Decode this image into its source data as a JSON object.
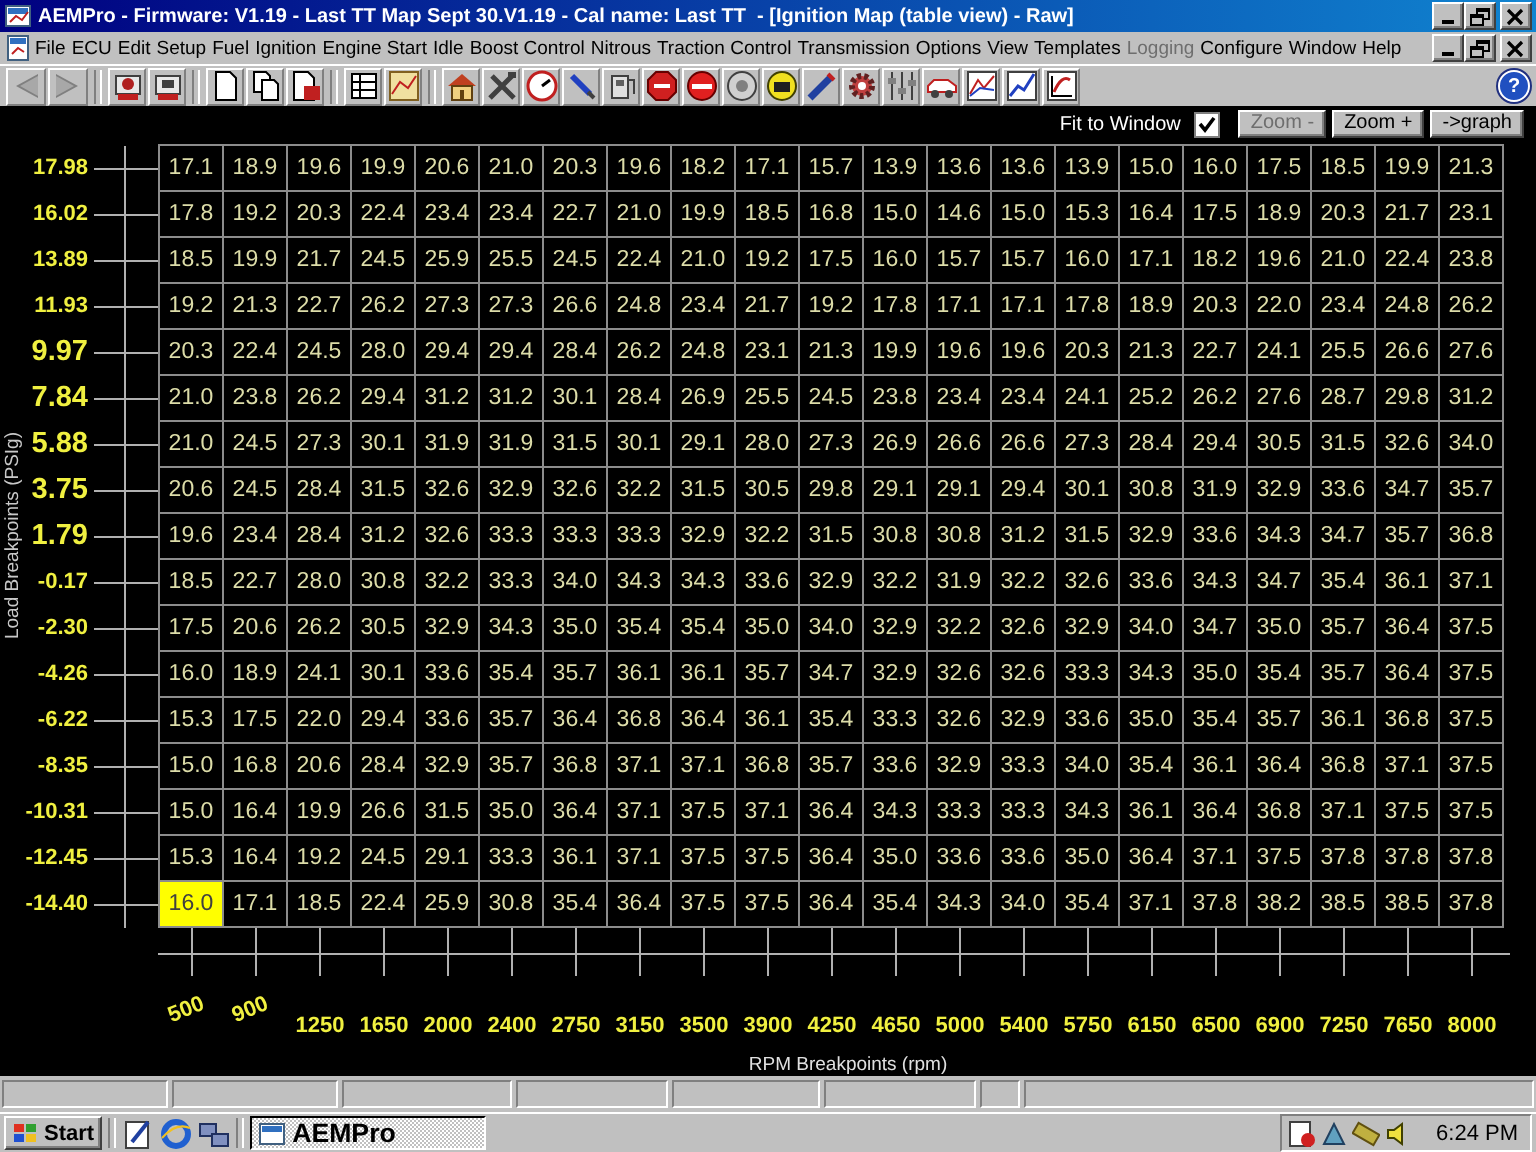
{
  "window": {
    "title": "AEMPro - Firmware: V1.19 - Last TT Map Sept 30.V1.19 - Cal name: Last TT  - [Ignition Map (table view) - Raw]"
  },
  "menu": [
    {
      "label": "File",
      "disabled": false
    },
    {
      "label": "ECU",
      "disabled": false
    },
    {
      "label": "Edit",
      "disabled": false
    },
    {
      "label": "Setup",
      "disabled": false
    },
    {
      "label": "Fuel",
      "disabled": false
    },
    {
      "label": "Ignition",
      "disabled": false
    },
    {
      "label": "Engine Start",
      "disabled": false
    },
    {
      "label": "Idle",
      "disabled": false
    },
    {
      "label": "Boost Control",
      "disabled": false
    },
    {
      "label": "Nitrous",
      "disabled": false
    },
    {
      "label": "Traction Control",
      "disabled": false
    },
    {
      "label": "Transmission",
      "disabled": false
    },
    {
      "label": "Options",
      "disabled": false
    },
    {
      "label": "View",
      "disabled": false
    },
    {
      "label": "Templates",
      "disabled": false
    },
    {
      "label": "Logging",
      "disabled": true
    },
    {
      "label": "Configure",
      "disabled": false
    },
    {
      "label": "Window",
      "disabled": false
    },
    {
      "label": "Help",
      "disabled": false
    }
  ],
  "toolbar": {
    "help_label": "?"
  },
  "view_controls": {
    "fit_label": "Fit to Window",
    "fit_checked": true,
    "buttons": [
      {
        "label": "Zoom -",
        "disabled": true
      },
      {
        "label": "Zoom +",
        "disabled": false
      },
      {
        "label": "->graph",
        "disabled": false
      }
    ]
  },
  "load_axis": {
    "title": "Load Breakpoints (PSIg)",
    "breakpoints": [
      {
        "label": "17.98",
        "large": false
      },
      {
        "label": "16.02",
        "large": false
      },
      {
        "label": "13.89",
        "large": false
      },
      {
        "label": "11.93",
        "large": false
      },
      {
        "label": "9.97",
        "large": true
      },
      {
        "label": "7.84",
        "large": true
      },
      {
        "label": "5.88",
        "large": true
      },
      {
        "label": "3.75",
        "large": true
      },
      {
        "label": "1.79",
        "large": true
      },
      {
        "label": "-0.17",
        "large": false
      },
      {
        "label": "-2.30",
        "large": false
      },
      {
        "label": "-4.26",
        "large": false
      },
      {
        "label": "-6.22",
        "large": false
      },
      {
        "label": "-8.35",
        "large": false
      },
      {
        "label": "-10.31",
        "large": false
      },
      {
        "label": "-12.45",
        "large": false
      },
      {
        "label": "-14.40",
        "large": false
      }
    ]
  },
  "rpm_axis": {
    "title": "RPM Breakpoints (rpm)",
    "breakpoints": [
      {
        "label": "500",
        "rotated": true
      },
      {
        "label": "900",
        "rotated": true
      },
      {
        "label": "1250",
        "rotated": false
      },
      {
        "label": "1650",
        "rotated": false
      },
      {
        "label": "2000",
        "rotated": false
      },
      {
        "label": "2400",
        "rotated": false
      },
      {
        "label": "2750",
        "rotated": false
      },
      {
        "label": "3150",
        "rotated": false
      },
      {
        "label": "3500",
        "rotated": false
      },
      {
        "label": "3900",
        "rotated": false
      },
      {
        "label": "4250",
        "rotated": false
      },
      {
        "label": "4650",
        "rotated": false
      },
      {
        "label": "5000",
        "rotated": false
      },
      {
        "label": "5400",
        "rotated": false
      },
      {
        "label": "5750",
        "rotated": false
      },
      {
        "label": "6150",
        "rotated": false
      },
      {
        "label": "6500",
        "rotated": false
      },
      {
        "label": "6900",
        "rotated": false
      },
      {
        "label": "7250",
        "rotated": false
      },
      {
        "label": "7650",
        "rotated": false
      },
      {
        "label": "8000",
        "rotated": false
      }
    ]
  },
  "table": {
    "rows": [
      {
        "cells": [
          {
            "value": "17.1",
            "selected": false
          },
          {
            "value": "18.9",
            "selected": false
          },
          {
            "value": "19.6",
            "selected": false
          },
          {
            "value": "19.9",
            "selected": false
          },
          {
            "value": "20.6",
            "selected": false
          },
          {
            "value": "21.0",
            "selected": false
          },
          {
            "value": "20.3",
            "selected": false
          },
          {
            "value": "19.6",
            "selected": false
          },
          {
            "value": "18.2",
            "selected": false
          },
          {
            "value": "17.1",
            "selected": false
          },
          {
            "value": "15.7",
            "selected": false
          },
          {
            "value": "13.9",
            "selected": false
          },
          {
            "value": "13.6",
            "selected": false
          },
          {
            "value": "13.6",
            "selected": false
          },
          {
            "value": "13.9",
            "selected": false
          },
          {
            "value": "15.0",
            "selected": false
          },
          {
            "value": "16.0",
            "selected": false
          },
          {
            "value": "17.5",
            "selected": false
          },
          {
            "value": "18.5",
            "selected": false
          },
          {
            "value": "19.9",
            "selected": false
          },
          {
            "value": "21.3",
            "selected": false
          }
        ]
      },
      {
        "cells": [
          {
            "value": "17.8",
            "selected": false
          },
          {
            "value": "19.2",
            "selected": false
          },
          {
            "value": "20.3",
            "selected": false
          },
          {
            "value": "22.4",
            "selected": false
          },
          {
            "value": "23.4",
            "selected": false
          },
          {
            "value": "23.4",
            "selected": false
          },
          {
            "value": "22.7",
            "selected": false
          },
          {
            "value": "21.0",
            "selected": false
          },
          {
            "value": "19.9",
            "selected": false
          },
          {
            "value": "18.5",
            "selected": false
          },
          {
            "value": "16.8",
            "selected": false
          },
          {
            "value": "15.0",
            "selected": false
          },
          {
            "value": "14.6",
            "selected": false
          },
          {
            "value": "15.0",
            "selected": false
          },
          {
            "value": "15.3",
            "selected": false
          },
          {
            "value": "16.4",
            "selected": false
          },
          {
            "value": "17.5",
            "selected": false
          },
          {
            "value": "18.9",
            "selected": false
          },
          {
            "value": "20.3",
            "selected": false
          },
          {
            "value": "21.7",
            "selected": false
          },
          {
            "value": "23.1",
            "selected": false
          }
        ]
      },
      {
        "cells": [
          {
            "value": "18.5",
            "selected": false
          },
          {
            "value": "19.9",
            "selected": false
          },
          {
            "value": "21.7",
            "selected": false
          },
          {
            "value": "24.5",
            "selected": false
          },
          {
            "value": "25.9",
            "selected": false
          },
          {
            "value": "25.5",
            "selected": false
          },
          {
            "value": "24.5",
            "selected": false
          },
          {
            "value": "22.4",
            "selected": false
          },
          {
            "value": "21.0",
            "selected": false
          },
          {
            "value": "19.2",
            "selected": false
          },
          {
            "value": "17.5",
            "selected": false
          },
          {
            "value": "16.0",
            "selected": false
          },
          {
            "value": "15.7",
            "selected": false
          },
          {
            "value": "15.7",
            "selected": false
          },
          {
            "value": "16.0",
            "selected": false
          },
          {
            "value": "17.1",
            "selected": false
          },
          {
            "value": "18.2",
            "selected": false
          },
          {
            "value": "19.6",
            "selected": false
          },
          {
            "value": "21.0",
            "selected": false
          },
          {
            "value": "22.4",
            "selected": false
          },
          {
            "value": "23.8",
            "selected": false
          }
        ]
      },
      {
        "cells": [
          {
            "value": "19.2",
            "selected": false
          },
          {
            "value": "21.3",
            "selected": false
          },
          {
            "value": "22.7",
            "selected": false
          },
          {
            "value": "26.2",
            "selected": false
          },
          {
            "value": "27.3",
            "selected": false
          },
          {
            "value": "27.3",
            "selected": false
          },
          {
            "value": "26.6",
            "selected": false
          },
          {
            "value": "24.8",
            "selected": false
          },
          {
            "value": "23.4",
            "selected": false
          },
          {
            "value": "21.7",
            "selected": false
          },
          {
            "value": "19.2",
            "selected": false
          },
          {
            "value": "17.8",
            "selected": false
          },
          {
            "value": "17.1",
            "selected": false
          },
          {
            "value": "17.1",
            "selected": false
          },
          {
            "value": "17.8",
            "selected": false
          },
          {
            "value": "18.9",
            "selected": false
          },
          {
            "value": "20.3",
            "selected": false
          },
          {
            "value": "22.0",
            "selected": false
          },
          {
            "value": "23.4",
            "selected": false
          },
          {
            "value": "24.8",
            "selected": false
          },
          {
            "value": "26.2",
            "selected": false
          }
        ]
      },
      {
        "cells": [
          {
            "value": "20.3",
            "selected": false
          },
          {
            "value": "22.4",
            "selected": false
          },
          {
            "value": "24.5",
            "selected": false
          },
          {
            "value": "28.0",
            "selected": false
          },
          {
            "value": "29.4",
            "selected": false
          },
          {
            "value": "29.4",
            "selected": false
          },
          {
            "value": "28.4",
            "selected": false
          },
          {
            "value": "26.2",
            "selected": false
          },
          {
            "value": "24.8",
            "selected": false
          },
          {
            "value": "23.1",
            "selected": false
          },
          {
            "value": "21.3",
            "selected": false
          },
          {
            "value": "19.9",
            "selected": false
          },
          {
            "value": "19.6",
            "selected": false
          },
          {
            "value": "19.6",
            "selected": false
          },
          {
            "value": "20.3",
            "selected": false
          },
          {
            "value": "21.3",
            "selected": false
          },
          {
            "value": "22.7",
            "selected": false
          },
          {
            "value": "24.1",
            "selected": false
          },
          {
            "value": "25.5",
            "selected": false
          },
          {
            "value": "26.6",
            "selected": false
          },
          {
            "value": "27.6",
            "selected": false
          }
        ]
      },
      {
        "cells": [
          {
            "value": "21.0",
            "selected": false
          },
          {
            "value": "23.8",
            "selected": false
          },
          {
            "value": "26.2",
            "selected": false
          },
          {
            "value": "29.4",
            "selected": false
          },
          {
            "value": "31.2",
            "selected": false
          },
          {
            "value": "31.2",
            "selected": false
          },
          {
            "value": "30.1",
            "selected": false
          },
          {
            "value": "28.4",
            "selected": false
          },
          {
            "value": "26.9",
            "selected": false
          },
          {
            "value": "25.5",
            "selected": false
          },
          {
            "value": "24.5",
            "selected": false
          },
          {
            "value": "23.8",
            "selected": false
          },
          {
            "value": "23.4",
            "selected": false
          },
          {
            "value": "23.4",
            "selected": false
          },
          {
            "value": "24.1",
            "selected": false
          },
          {
            "value": "25.2",
            "selected": false
          },
          {
            "value": "26.2",
            "selected": false
          },
          {
            "value": "27.6",
            "selected": false
          },
          {
            "value": "28.7",
            "selected": false
          },
          {
            "value": "29.8",
            "selected": false
          },
          {
            "value": "31.2",
            "selected": false
          }
        ]
      },
      {
        "cells": [
          {
            "value": "21.0",
            "selected": false
          },
          {
            "value": "24.5",
            "selected": false
          },
          {
            "value": "27.3",
            "selected": false
          },
          {
            "value": "30.1",
            "selected": false
          },
          {
            "value": "31.9",
            "selected": false
          },
          {
            "value": "31.9",
            "selected": false
          },
          {
            "value": "31.5",
            "selected": false
          },
          {
            "value": "30.1",
            "selected": false
          },
          {
            "value": "29.1",
            "selected": false
          },
          {
            "value": "28.0",
            "selected": false
          },
          {
            "value": "27.3",
            "selected": false
          },
          {
            "value": "26.9",
            "selected": false
          },
          {
            "value": "26.6",
            "selected": false
          },
          {
            "value": "26.6",
            "selected": false
          },
          {
            "value": "27.3",
            "selected": false
          },
          {
            "value": "28.4",
            "selected": false
          },
          {
            "value": "29.4",
            "selected": false
          },
          {
            "value": "30.5",
            "selected": false
          },
          {
            "value": "31.5",
            "selected": false
          },
          {
            "value": "32.6",
            "selected": false
          },
          {
            "value": "34.0",
            "selected": false
          }
        ]
      },
      {
        "cells": [
          {
            "value": "20.6",
            "selected": false
          },
          {
            "value": "24.5",
            "selected": false
          },
          {
            "value": "28.4",
            "selected": false
          },
          {
            "value": "31.5",
            "selected": false
          },
          {
            "value": "32.6",
            "selected": false
          },
          {
            "value": "32.9",
            "selected": false
          },
          {
            "value": "32.6",
            "selected": false
          },
          {
            "value": "32.2",
            "selected": false
          },
          {
            "value": "31.5",
            "selected": false
          },
          {
            "value": "30.5",
            "selected": false
          },
          {
            "value": "29.8",
            "selected": false
          },
          {
            "value": "29.1",
            "selected": false
          },
          {
            "value": "29.1",
            "selected": false
          },
          {
            "value": "29.4",
            "selected": false
          },
          {
            "value": "30.1",
            "selected": false
          },
          {
            "value": "30.8",
            "selected": false
          },
          {
            "value": "31.9",
            "selected": false
          },
          {
            "value": "32.9",
            "selected": false
          },
          {
            "value": "33.6",
            "selected": false
          },
          {
            "value": "34.7",
            "selected": false
          },
          {
            "value": "35.7",
            "selected": false
          }
        ]
      },
      {
        "cells": [
          {
            "value": "19.6",
            "selected": false
          },
          {
            "value": "23.4",
            "selected": false
          },
          {
            "value": "28.4",
            "selected": false
          },
          {
            "value": "31.2",
            "selected": false
          },
          {
            "value": "32.6",
            "selected": false
          },
          {
            "value": "33.3",
            "selected": false
          },
          {
            "value": "33.3",
            "selected": false
          },
          {
            "value": "33.3",
            "selected": false
          },
          {
            "value": "32.9",
            "selected": false
          },
          {
            "value": "32.2",
            "selected": false
          },
          {
            "value": "31.5",
            "selected": false
          },
          {
            "value": "30.8",
            "selected": false
          },
          {
            "value": "30.8",
            "selected": false
          },
          {
            "value": "31.2",
            "selected": false
          },
          {
            "value": "31.5",
            "selected": false
          },
          {
            "value": "32.9",
            "selected": false
          },
          {
            "value": "33.6",
            "selected": false
          },
          {
            "value": "34.3",
            "selected": false
          },
          {
            "value": "34.7",
            "selected": false
          },
          {
            "value": "35.7",
            "selected": false
          },
          {
            "value": "36.8",
            "selected": false
          }
        ]
      },
      {
        "cells": [
          {
            "value": "18.5",
            "selected": false
          },
          {
            "value": "22.7",
            "selected": false
          },
          {
            "value": "28.0",
            "selected": false
          },
          {
            "value": "30.8",
            "selected": false
          },
          {
            "value": "32.2",
            "selected": false
          },
          {
            "value": "33.3",
            "selected": false
          },
          {
            "value": "34.0",
            "selected": false
          },
          {
            "value": "34.3",
            "selected": false
          },
          {
            "value": "34.3",
            "selected": false
          },
          {
            "value": "33.6",
            "selected": false
          },
          {
            "value": "32.9",
            "selected": false
          },
          {
            "value": "32.2",
            "selected": false
          },
          {
            "value": "31.9",
            "selected": false
          },
          {
            "value": "32.2",
            "selected": false
          },
          {
            "value": "32.6",
            "selected": false
          },
          {
            "value": "33.6",
            "selected": false
          },
          {
            "value": "34.3",
            "selected": false
          },
          {
            "value": "34.7",
            "selected": false
          },
          {
            "value": "35.4",
            "selected": false
          },
          {
            "value": "36.1",
            "selected": false
          },
          {
            "value": "37.1",
            "selected": false
          }
        ]
      },
      {
        "cells": [
          {
            "value": "17.5",
            "selected": false
          },
          {
            "value": "20.6",
            "selected": false
          },
          {
            "value": "26.2",
            "selected": false
          },
          {
            "value": "30.5",
            "selected": false
          },
          {
            "value": "32.9",
            "selected": false
          },
          {
            "value": "34.3",
            "selected": false
          },
          {
            "value": "35.0",
            "selected": false
          },
          {
            "value": "35.4",
            "selected": false
          },
          {
            "value": "35.4",
            "selected": false
          },
          {
            "value": "35.0",
            "selected": false
          },
          {
            "value": "34.0",
            "selected": false
          },
          {
            "value": "32.9",
            "selected": false
          },
          {
            "value": "32.2",
            "selected": false
          },
          {
            "value": "32.6",
            "selected": false
          },
          {
            "value": "32.9",
            "selected": false
          },
          {
            "value": "34.0",
            "selected": false
          },
          {
            "value": "34.7",
            "selected": false
          },
          {
            "value": "35.0",
            "selected": false
          },
          {
            "value": "35.7",
            "selected": false
          },
          {
            "value": "36.4",
            "selected": false
          },
          {
            "value": "37.5",
            "selected": false
          }
        ]
      },
      {
        "cells": [
          {
            "value": "16.0",
            "selected": false
          },
          {
            "value": "18.9",
            "selected": false
          },
          {
            "value": "24.1",
            "selected": false
          },
          {
            "value": "30.1",
            "selected": false
          },
          {
            "value": "33.6",
            "selected": false
          },
          {
            "value": "35.4",
            "selected": false
          },
          {
            "value": "35.7",
            "selected": false
          },
          {
            "value": "36.1",
            "selected": false
          },
          {
            "value": "36.1",
            "selected": false
          },
          {
            "value": "35.7",
            "selected": false
          },
          {
            "value": "34.7",
            "selected": false
          },
          {
            "value": "32.9",
            "selected": false
          },
          {
            "value": "32.6",
            "selected": false
          },
          {
            "value": "32.6",
            "selected": false
          },
          {
            "value": "33.3",
            "selected": false
          },
          {
            "value": "34.3",
            "selected": false
          },
          {
            "value": "35.0",
            "selected": false
          },
          {
            "value": "35.4",
            "selected": false
          },
          {
            "value": "35.7",
            "selected": false
          },
          {
            "value": "36.4",
            "selected": false
          },
          {
            "value": "37.5",
            "selected": false
          }
        ]
      },
      {
        "cells": [
          {
            "value": "15.3",
            "selected": false
          },
          {
            "value": "17.5",
            "selected": false
          },
          {
            "value": "22.0",
            "selected": false
          },
          {
            "value": "29.4",
            "selected": false
          },
          {
            "value": "33.6",
            "selected": false
          },
          {
            "value": "35.7",
            "selected": false
          },
          {
            "value": "36.4",
            "selected": false
          },
          {
            "value": "36.8",
            "selected": false
          },
          {
            "value": "36.4",
            "selected": false
          },
          {
            "value": "36.1",
            "selected": false
          },
          {
            "value": "35.4",
            "selected": false
          },
          {
            "value": "33.3",
            "selected": false
          },
          {
            "value": "32.6",
            "selected": false
          },
          {
            "value": "32.9",
            "selected": false
          },
          {
            "value": "33.6",
            "selected": false
          },
          {
            "value": "35.0",
            "selected": false
          },
          {
            "value": "35.4",
            "selected": false
          },
          {
            "value": "35.7",
            "selected": false
          },
          {
            "value": "36.1",
            "selected": false
          },
          {
            "value": "36.8",
            "selected": false
          },
          {
            "value": "37.5",
            "selected": false
          }
        ]
      },
      {
        "cells": [
          {
            "value": "15.0",
            "selected": false
          },
          {
            "value": "16.8",
            "selected": false
          },
          {
            "value": "20.6",
            "selected": false
          },
          {
            "value": "28.4",
            "selected": false
          },
          {
            "value": "32.9",
            "selected": false
          },
          {
            "value": "35.7",
            "selected": false
          },
          {
            "value": "36.8",
            "selected": false
          },
          {
            "value": "37.1",
            "selected": false
          },
          {
            "value": "37.1",
            "selected": false
          },
          {
            "value": "36.8",
            "selected": false
          },
          {
            "value": "35.7",
            "selected": false
          },
          {
            "value": "33.6",
            "selected": false
          },
          {
            "value": "32.9",
            "selected": false
          },
          {
            "value": "33.3",
            "selected": false
          },
          {
            "value": "34.0",
            "selected": false
          },
          {
            "value": "35.4",
            "selected": false
          },
          {
            "value": "36.1",
            "selected": false
          },
          {
            "value": "36.4",
            "selected": false
          },
          {
            "value": "36.8",
            "selected": false
          },
          {
            "value": "37.1",
            "selected": false
          },
          {
            "value": "37.5",
            "selected": false
          }
        ]
      },
      {
        "cells": [
          {
            "value": "15.0",
            "selected": false
          },
          {
            "value": "16.4",
            "selected": false
          },
          {
            "value": "19.9",
            "selected": false
          },
          {
            "value": "26.6",
            "selected": false
          },
          {
            "value": "31.5",
            "selected": false
          },
          {
            "value": "35.0",
            "selected": false
          },
          {
            "value": "36.4",
            "selected": false
          },
          {
            "value": "37.1",
            "selected": false
          },
          {
            "value": "37.5",
            "selected": false
          },
          {
            "value": "37.1",
            "selected": false
          },
          {
            "value": "36.4",
            "selected": false
          },
          {
            "value": "34.3",
            "selected": false
          },
          {
            "value": "33.3",
            "selected": false
          },
          {
            "value": "33.3",
            "selected": false
          },
          {
            "value": "34.3",
            "selected": false
          },
          {
            "value": "36.1",
            "selected": false
          },
          {
            "value": "36.4",
            "selected": false
          },
          {
            "value": "36.8",
            "selected": false
          },
          {
            "value": "37.1",
            "selected": false
          },
          {
            "value": "37.5",
            "selected": false
          },
          {
            "value": "37.5",
            "selected": false
          }
        ]
      },
      {
        "cells": [
          {
            "value": "15.3",
            "selected": false
          },
          {
            "value": "16.4",
            "selected": false
          },
          {
            "value": "19.2",
            "selected": false
          },
          {
            "value": "24.5",
            "selected": false
          },
          {
            "value": "29.1",
            "selected": false
          },
          {
            "value": "33.3",
            "selected": false
          },
          {
            "value": "36.1",
            "selected": false
          },
          {
            "value": "37.1",
            "selected": false
          },
          {
            "value": "37.5",
            "selected": false
          },
          {
            "value": "37.5",
            "selected": false
          },
          {
            "value": "36.4",
            "selected": false
          },
          {
            "value": "35.0",
            "selected": false
          },
          {
            "value": "33.6",
            "selected": false
          },
          {
            "value": "33.6",
            "selected": false
          },
          {
            "value": "35.0",
            "selected": false
          },
          {
            "value": "36.4",
            "selected": false
          },
          {
            "value": "37.1",
            "selected": false
          },
          {
            "value": "37.5",
            "selected": false
          },
          {
            "value": "37.8",
            "selected": false
          },
          {
            "value": "37.8",
            "selected": false
          },
          {
            "value": "37.8",
            "selected": false
          }
        ]
      },
      {
        "cells": [
          {
            "value": "16.0",
            "selected": true
          },
          {
            "value": "17.1",
            "selected": false
          },
          {
            "value": "18.5",
            "selected": false
          },
          {
            "value": "22.4",
            "selected": false
          },
          {
            "value": "25.9",
            "selected": false
          },
          {
            "value": "30.8",
            "selected": false
          },
          {
            "value": "35.4",
            "selected": false
          },
          {
            "value": "36.4",
            "selected": false
          },
          {
            "value": "37.5",
            "selected": false
          },
          {
            "value": "37.5",
            "selected": false
          },
          {
            "value": "36.4",
            "selected": false
          },
          {
            "value": "35.4",
            "selected": false
          },
          {
            "value": "34.3",
            "selected": false
          },
          {
            "value": "34.0",
            "selected": false
          },
          {
            "value": "35.4",
            "selected": false
          },
          {
            "value": "37.1",
            "selected": false
          },
          {
            "value": "37.8",
            "selected": false
          },
          {
            "value": "38.2",
            "selected": false
          },
          {
            "value": "38.5",
            "selected": false
          },
          {
            "value": "38.5",
            "selected": false
          },
          {
            "value": "37.8",
            "selected": false
          }
        ]
      }
    ]
  },
  "taskbar": {
    "start": "Start",
    "tasks": [
      {
        "label": "AEMPro",
        "selected": true
      }
    ],
    "clock": "6:24 PM"
  }
}
